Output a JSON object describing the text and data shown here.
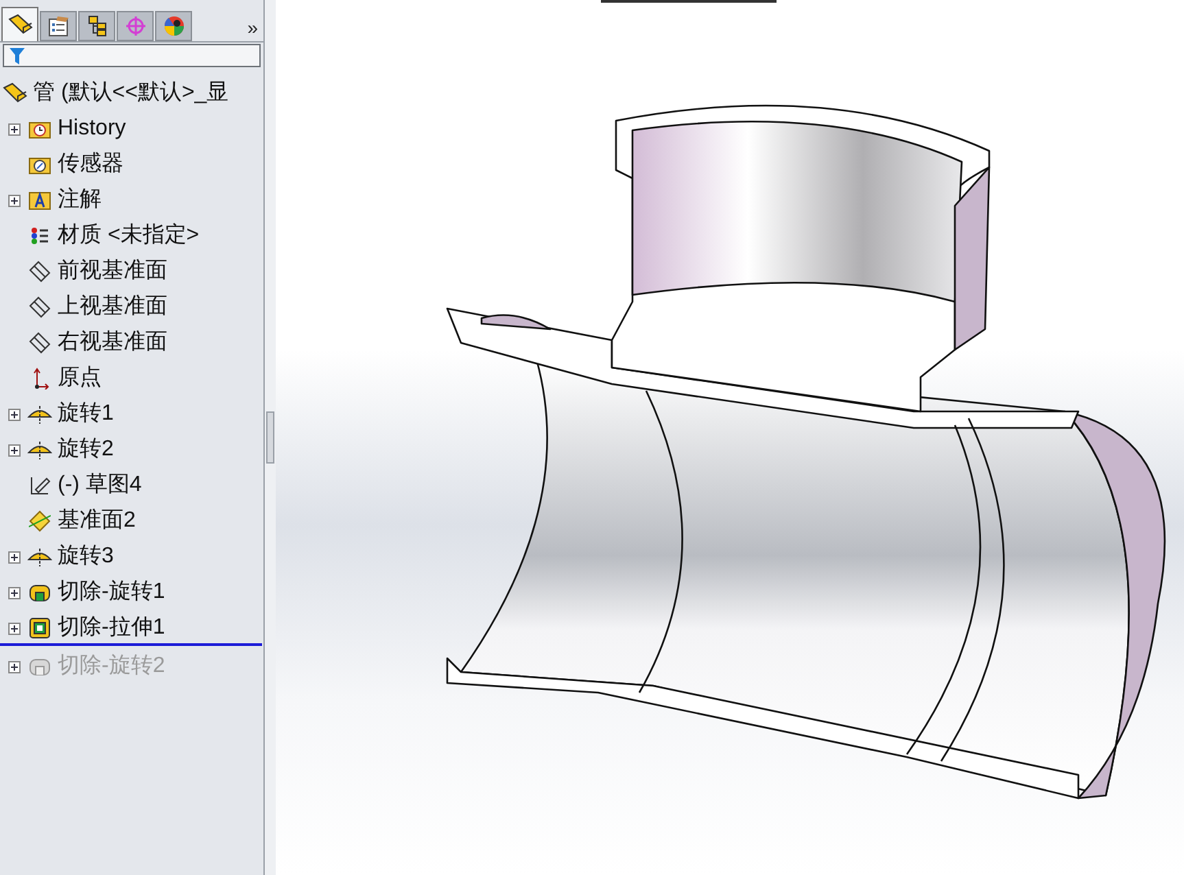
{
  "panel_tabs": [
    {
      "kind": "part",
      "selected": true
    },
    {
      "kind": "properties",
      "selected": false
    },
    {
      "kind": "configurations",
      "selected": false
    },
    {
      "kind": "dimxpert",
      "selected": false
    },
    {
      "kind": "appearance",
      "selected": false
    }
  ],
  "more_tabs": "»",
  "feature_tree": {
    "root": {
      "label": "管  (默认<<默认>_显"
    },
    "items": [
      {
        "kind": "history",
        "label": "History",
        "expandable": true,
        "suppressed": false
      },
      {
        "kind": "sensor",
        "label": "传感器",
        "expandable": false,
        "suppressed": false
      },
      {
        "kind": "annotation",
        "label": "注解",
        "expandable": true,
        "suppressed": false
      },
      {
        "kind": "material",
        "label": "材质 <未指定>",
        "expandable": false,
        "suppressed": false
      },
      {
        "kind": "plane",
        "label": "前视基准面",
        "expandable": false,
        "suppressed": false
      },
      {
        "kind": "plane",
        "label": "上视基准面",
        "expandable": false,
        "suppressed": false
      },
      {
        "kind": "plane",
        "label": "右视基准面",
        "expandable": false,
        "suppressed": false
      },
      {
        "kind": "origin",
        "label": "原点",
        "expandable": false,
        "suppressed": false
      },
      {
        "kind": "revolve",
        "label": "旋转1",
        "expandable": true,
        "suppressed": false
      },
      {
        "kind": "revolve",
        "label": "旋转2",
        "expandable": true,
        "suppressed": false
      },
      {
        "kind": "sketch",
        "label": "(-) 草图4",
        "expandable": false,
        "suppressed": false
      },
      {
        "kind": "ref-plane",
        "label": "基准面2",
        "expandable": false,
        "suppressed": false
      },
      {
        "kind": "revolve",
        "label": "旋转3",
        "expandable": true,
        "suppressed": false
      },
      {
        "kind": "cut-revolve",
        "label": "切除-旋转1",
        "expandable": true,
        "suppressed": false
      },
      {
        "kind": "cut-extrude",
        "label": "切除-拉伸1",
        "expandable": true,
        "suppressed": false
      },
      {
        "kind": "rollback-bar"
      },
      {
        "kind": "cut-revolve",
        "label": "切除-旋转2",
        "expandable": true,
        "suppressed": true
      }
    ]
  }
}
